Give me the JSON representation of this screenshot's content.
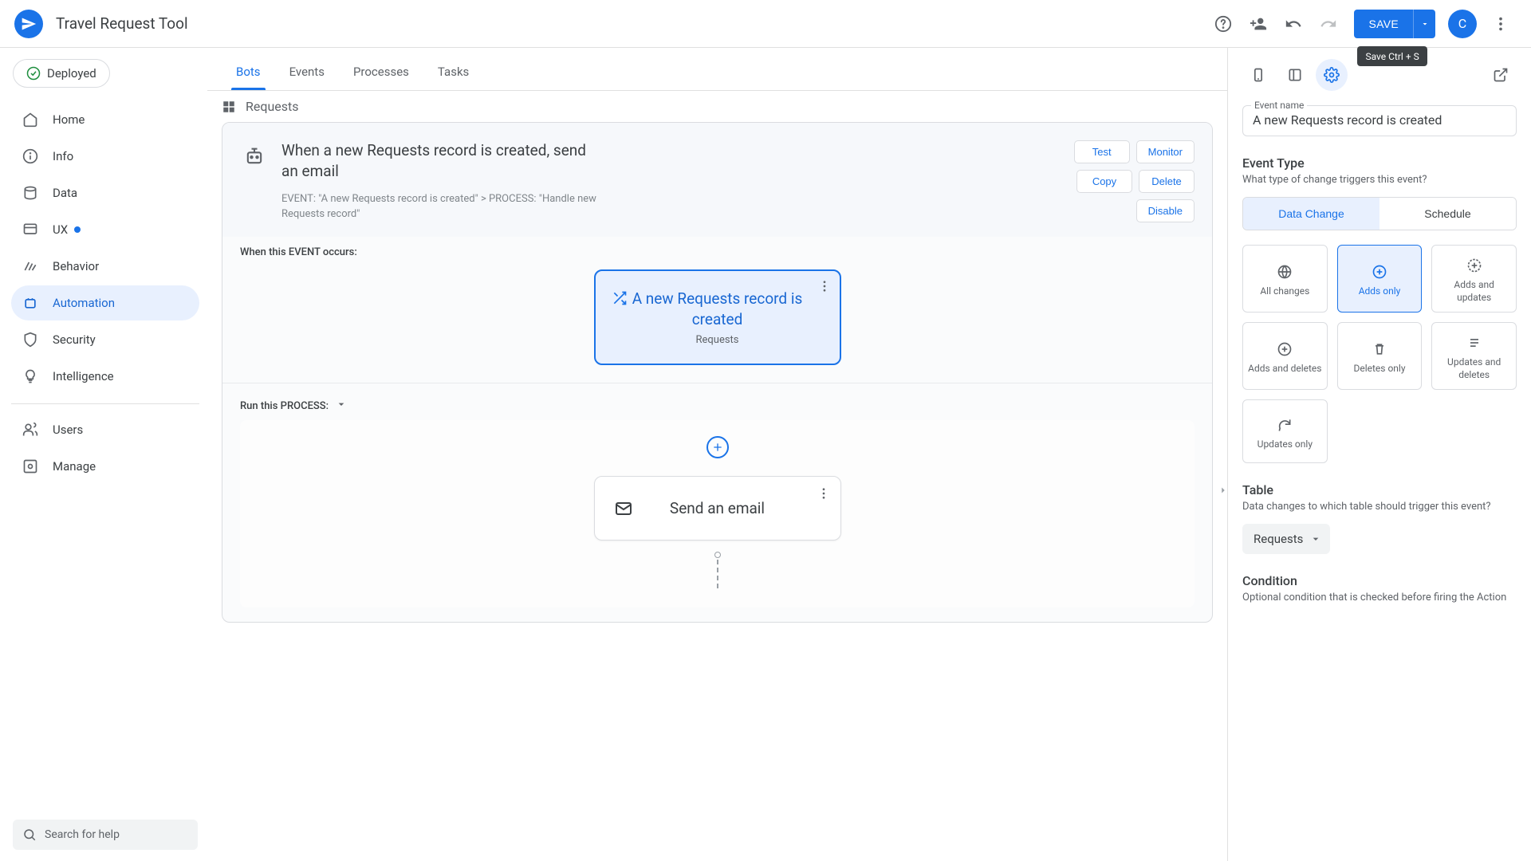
{
  "app": {
    "title": "Travel Request Tool"
  },
  "topbar": {
    "save": "SAVE",
    "save_tooltip": "Save Ctrl + S",
    "avatar": "C"
  },
  "deploy_status": "Deployed",
  "nav": [
    {
      "id": "home",
      "label": "Home"
    },
    {
      "id": "info",
      "label": "Info"
    },
    {
      "id": "data",
      "label": "Data"
    },
    {
      "id": "ux",
      "label": "UX",
      "has_dot": true
    },
    {
      "id": "behavior",
      "label": "Behavior"
    },
    {
      "id": "automation",
      "label": "Automation",
      "active": true
    },
    {
      "id": "security",
      "label": "Security"
    },
    {
      "id": "intelligence",
      "label": "Intelligence"
    }
  ],
  "nav2": [
    {
      "id": "users",
      "label": "Users"
    },
    {
      "id": "manage",
      "label": "Manage"
    }
  ],
  "search_placeholder": "Search for help",
  "tabs": [
    {
      "label": "Bots",
      "active": true
    },
    {
      "label": "Events"
    },
    {
      "label": "Processes"
    },
    {
      "label": "Tasks"
    }
  ],
  "breadcrumb": "Requests",
  "bot": {
    "title": "When a new Requests record is created, send an email",
    "subtitle": "EVENT: \"A new Requests record is created\" > PROCESS: \"Handle new Requests record\"",
    "actions": {
      "test": "Test",
      "monitor": "Monitor",
      "copy": "Copy",
      "delete": "Delete",
      "disable": "Disable"
    },
    "event_section_label": "When this EVENT occurs:",
    "event_node": {
      "title": "A new Requests record is created",
      "subtitle": "Requests"
    },
    "process_section_label": "Run this PROCESS:",
    "step_node": {
      "title": "Send an email"
    }
  },
  "right": {
    "event_name_label": "Event name",
    "event_name_value": "A new Requests record is created",
    "event_type_title": "Event Type",
    "event_type_desc": "What type of change triggers this event?",
    "toggle": {
      "data_change": "Data Change",
      "schedule": "Schedule"
    },
    "options": [
      {
        "id": "all",
        "label": "All changes"
      },
      {
        "id": "adds",
        "label": "Adds only",
        "selected": true
      },
      {
        "id": "addupd",
        "label": "Adds and updates"
      },
      {
        "id": "adddel",
        "label": "Adds and deletes"
      },
      {
        "id": "del",
        "label": "Deletes only"
      },
      {
        "id": "upddel",
        "label": "Updates and deletes"
      },
      {
        "id": "upd",
        "label": "Updates only"
      }
    ],
    "table_title": "Table",
    "table_desc": "Data changes to which table should trigger this event?",
    "table_value": "Requests",
    "condition_title": "Condition",
    "condition_desc": "Optional condition that is checked before firing the Action"
  }
}
